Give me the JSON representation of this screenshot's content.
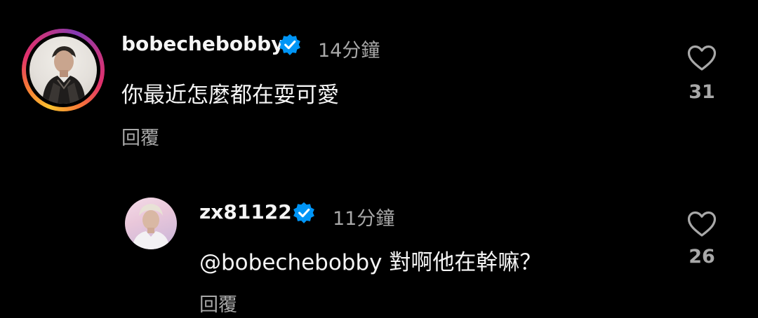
{
  "comments": [
    {
      "username": "bobechebobby",
      "verified": true,
      "time": "14分鐘",
      "text": "你最近怎麼都在耍可愛",
      "reply_label": "回覆",
      "likes": "31",
      "has_story_ring": true
    },
    {
      "username": "zx81122",
      "verified": true,
      "time": "11分鐘",
      "text": "@bobechebobby 對啊他在幹嘛？",
      "reply_label": "回覆",
      "likes": "26",
      "has_story_ring": false
    }
  ],
  "icons": {
    "verified": "verified-badge-icon",
    "like": "heart-outline-icon"
  },
  "colors": {
    "background": "#000000",
    "primary_text": "#f5f5f5",
    "secondary_text": "#a8a8a8",
    "verified_blue": "#0095f6"
  }
}
